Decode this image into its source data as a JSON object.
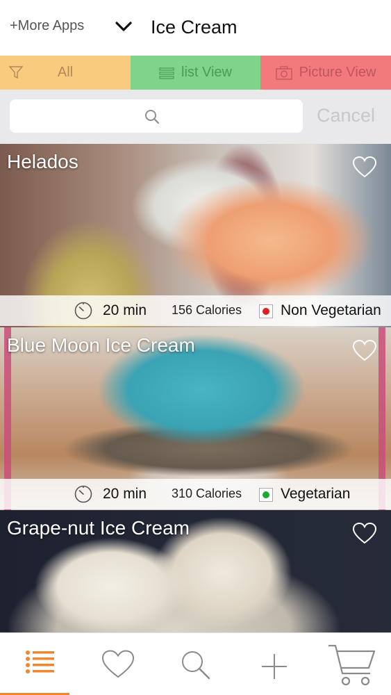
{
  "header": {
    "more_apps": "+More Apps",
    "title": "Ice Cream"
  },
  "filters": {
    "all": "All",
    "list_view": "list View",
    "picture_view": "Picture View"
  },
  "search": {
    "placeholder": "",
    "cancel": "Cancel"
  },
  "recipes": [
    {
      "name": "Helados",
      "time": "20 min",
      "calories": "156 Calories",
      "diet": "Non Vegetarian",
      "diet_color": "#e02020"
    },
    {
      "name": "Blue Moon Ice Cream",
      "time": "20 min",
      "calories": "310 Calories",
      "diet": "Vegetarian",
      "diet_color": "#1da830"
    },
    {
      "name": "Grape-nut Ice Cream"
    }
  ],
  "tabs": [
    "list-icon",
    "heart-icon",
    "search-icon",
    "plus-icon",
    "cart-icon"
  ],
  "colors": {
    "all_bg": "#f9cb7f",
    "list_bg": "#7fd48a",
    "picture_bg": "#f2797c",
    "accent": "#f0862d"
  }
}
